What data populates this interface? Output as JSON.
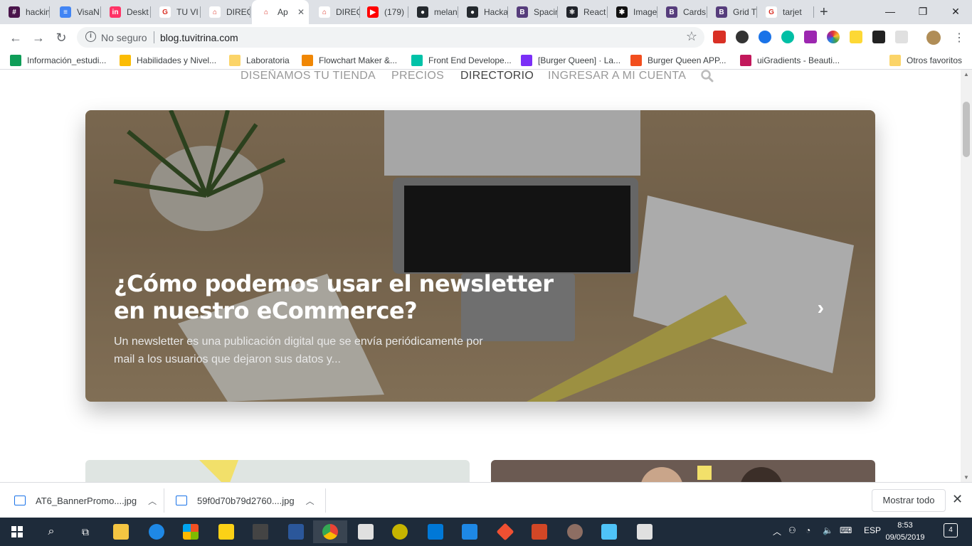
{
  "tabs": [
    {
      "label": "hackin",
      "color": "#4a154b",
      "glyph": "#"
    },
    {
      "label": "VisaN",
      "color": "#4285f4",
      "glyph": "≡"
    },
    {
      "label": "Deskt",
      "color": "#ff3366",
      "glyph": "in"
    },
    {
      "label": "TU VI",
      "color": "#ffffff",
      "glyph": "G"
    },
    {
      "label": "DIREC",
      "color": "#ffffff",
      "glyph": "⌂"
    },
    {
      "label": "Ap",
      "color": "#ffffff",
      "glyph": "⌂"
    },
    {
      "label": "DIREC",
      "color": "#ffffff",
      "glyph": "⌂"
    },
    {
      "label": "(179)",
      "color": "#ff0000",
      "glyph": "▶"
    },
    {
      "label": "melan",
      "color": "#24292e",
      "glyph": "●"
    },
    {
      "label": "Hacka",
      "color": "#24292e",
      "glyph": "●"
    },
    {
      "label": "Spacin",
      "color": "#563d7c",
      "glyph": "B"
    },
    {
      "label": "React",
      "color": "#20232a",
      "glyph": "⚛"
    },
    {
      "label": "Image",
      "color": "#111111",
      "glyph": "✱"
    },
    {
      "label": "Cards",
      "color": "#563d7c",
      "glyph": "B"
    },
    {
      "label": "Grid T",
      "color": "#563d7c",
      "glyph": "B"
    },
    {
      "label": "tarjet",
      "color": "#ffffff",
      "glyph": "G"
    }
  ],
  "address": {
    "security": "No seguro",
    "url": "blog.tuvitrina.com"
  },
  "bookmarks": [
    {
      "label": "Información_estudi...",
      "color": "#0f9d58"
    },
    {
      "label": "Habilidades y Nivel...",
      "color": "#fbbc04"
    },
    {
      "label": "Laboratoria",
      "color": "#fbd468"
    },
    {
      "label": "Flowchart Maker &...",
      "color": "#f08705"
    },
    {
      "label": "Front End Develope...",
      "color": "#00c2a8"
    },
    {
      "label": "[Burger Queen] · La...",
      "color": "#7b2ff7"
    },
    {
      "label": "Burger Queen APP...",
      "color": "#f24e1e"
    },
    {
      "label": "uiGradients - Beauti...",
      "color": "#c2185b"
    }
  ],
  "other_bookmarks": "Otros favoritos",
  "site_nav": [
    {
      "label": "DISEÑAMOS TU TIENDA",
      "active": false
    },
    {
      "label": "PRECIOS",
      "active": false
    },
    {
      "label": "DIRECTORIO",
      "active": true
    },
    {
      "label": "INGRESAR A MI CUENTA",
      "active": false
    }
  ],
  "hero": {
    "title": "¿Cómo podemos usar el newsletter en nuestro eCommerce?",
    "description": "Un newsletter es una publicación digital que se envía periódicamente por mail a los usuarios que dejaron sus datos y..."
  },
  "downloads": [
    {
      "file": "AT6_BannerPromo....jpg"
    },
    {
      "file": "59f0d70b79d2760....jpg"
    }
  ],
  "downloads_show_all": "Mostrar todo",
  "taskbar": {
    "lang": "ESP",
    "time": "8:53",
    "date": "09/05/2019",
    "notifications": "4"
  }
}
